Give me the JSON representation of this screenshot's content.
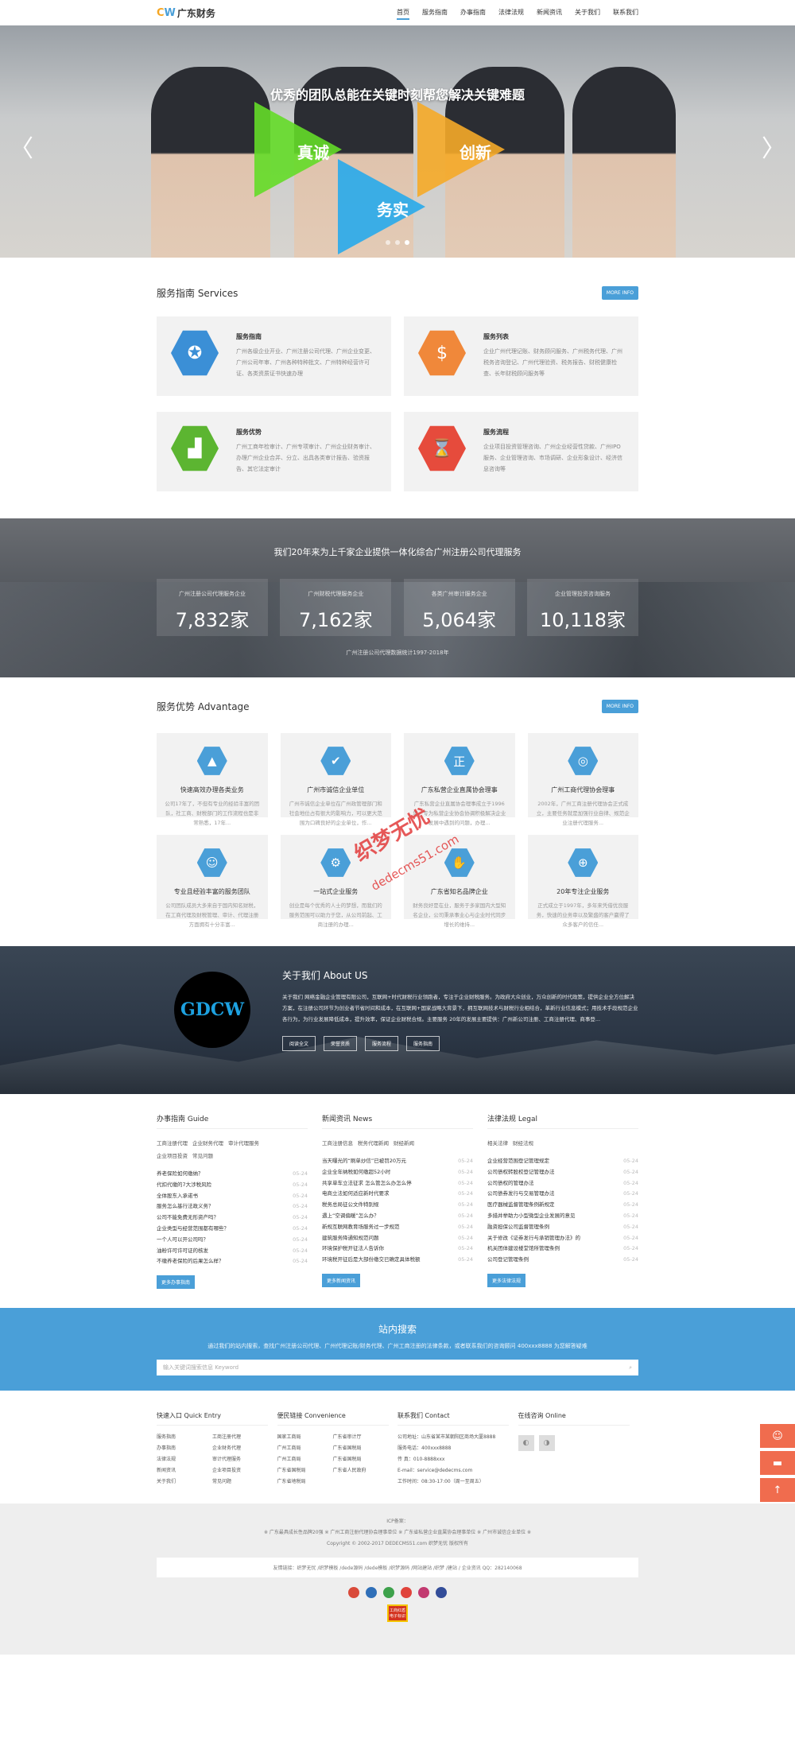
{
  "header": {
    "logo_c": "C",
    "logo_w": "W",
    "logo_text": "广东财务",
    "nav": [
      "首页",
      "服务指南",
      "办事指南",
      "法律法规",
      "新闻资讯",
      "关于我们",
      "联系我们"
    ]
  },
  "banner": {
    "title": "优秀的团队总能在关键时刻帮您解决关键难题",
    "words": [
      "真诚",
      "创新",
      "务实"
    ],
    "prev": "〈",
    "next": "〉"
  },
  "services": {
    "title": "服务指南 Services",
    "more": "MORE INFO",
    "items": [
      {
        "title": "服务指南",
        "desc": "广州各级企业开业、广州注册公司代理、广州企业变更、广州公司年审、广州各种特种批文、广州特种经营许可证、各类资质证书快速办理",
        "color": "#3b8fd6",
        "icon": "award-icon",
        "glyph": "✪"
      },
      {
        "title": "服务列表",
        "desc": "企业广州代理记账、财务顾问服务、广州税务代理、广州税务咨询登记、广州代理验资、税务报告、财税健康检查、长年财税顾问服务等",
        "color": "#f0883a",
        "icon": "money-bag-icon",
        "glyph": "$"
      },
      {
        "title": "服务优势",
        "desc": "广州工商年检审计、广州专项审计、广州企业财务审计、办理广州企业合并、分立、出具各类审计报告、验资报告、其它法定审计",
        "color": "#5cb531",
        "icon": "chart-icon",
        "glyph": "▟"
      },
      {
        "title": "服务流程",
        "desc": "企业项目投资管理咨询、广州企业经营性贷款、广州IPO服务、企业管理咨询、市场调研、企业形象设计、经济信息咨询等",
        "color": "#e64b3c",
        "icon": "hourglass-icon",
        "glyph": "⌛"
      }
    ]
  },
  "stats": {
    "title": "我们20年来为上千家企业提供一体化综合广州注册公司代理服务",
    "items": [
      {
        "label": "广州注册公司代理服务企业",
        "value": "7,832家"
      },
      {
        "label": "广州财税代理服务企业",
        "value": "7,162家"
      },
      {
        "label": "各类广州审计服务企业",
        "value": "5,064家"
      },
      {
        "label": "企业管理投资咨询服务",
        "value": "10,118家"
      }
    ],
    "footnote": "广州注册公司代理数据统计1997-2018年"
  },
  "advantage": {
    "title": "服务优势 Advantage",
    "more": "MORE INFO",
    "items": [
      {
        "title": "快速高效办理各类业务",
        "desc": "公司17年了，不但有专业的经验丰富的团队，社工商、财税部门的工作流程也是非常熟悉，17年...",
        "icon": "chart-up-icon",
        "glyph": "▲"
      },
      {
        "title": "广州市诚信企业单位",
        "desc": "广州市诚信企业单位在广州政管理部门和社会地位占有很大的影响力，可以更大范围为口碑良好的企业单位，作...",
        "icon": "shield-check-icon",
        "glyph": "✔"
      },
      {
        "title": "广东私营企业直属协会理事",
        "desc": "广东私营企业直属协会理事成立于1996年、专为私营企业协会协调积极解决企业发展中遇到的问题，办理...",
        "icon": "stamp-icon",
        "glyph": "正"
      },
      {
        "title": "广州工商代理协会理事",
        "desc": "2002年，广州工商注册代理协会正式成立，主要任务就是加强行业自律、规范企业注册代理服务...",
        "icon": "badge-icon",
        "glyph": "◎"
      },
      {
        "title": "专业且经验丰富的服务团队",
        "desc": "公司团队成员大多来自于国内知名财税，在工商代理及财税管理、审计、代理注册方面拥有十分丰富...",
        "icon": "team-icon",
        "glyph": "☺"
      },
      {
        "title": "一站式企业服务",
        "desc": "创业是每个优秀的人士的梦想，而我们的服务范围可以助力于您，从公司前起、工商注册的办理...",
        "icon": "gears-icon",
        "glyph": "⚙"
      },
      {
        "title": "广东省知名品牌企业",
        "desc": "财务良好是在业，服务于多家国内大型知名企业，公司秉承事业心与企业时代同步增长的维持...",
        "icon": "thumbs-up-icon",
        "glyph": "✋"
      },
      {
        "title": "20年专注企业服务",
        "desc": "正式成立于1997年，多年来凭借优良服务，快速的业务审以及繁盛的客户赢得了众多客户的信任...",
        "icon": "target-icon",
        "glyph": "⊕"
      }
    ]
  },
  "about": {
    "logo": "GDCW",
    "title": "关于我们 About US",
    "text": "关于我们 网络金融企业管理有限公司，互联网+时代财税行业领跑者，专注于企业财税服务。为政府大众创业，万众创新的时代政策，提供企业全方位解决方案，在注册公司环节为创业者节省时间和成本，在互联网+国家战略大背景下，拥互联网技术与财税行业相结合，革新行业信息模式；用技术手段规范企业各行为，为行业发展降低成本，提升效率，保证企业财税合规。主要服务 20年的发展主要提供：广州新公司注册、工商注册代理、商事登...",
    "buttons": [
      "阅读全文",
      "荣誉资质",
      "服务流程",
      "服务指南"
    ]
  },
  "news": {
    "guide": {
      "title": "办事指南 Guide",
      "tags": [
        "工商注册代理",
        "企业财务代理",
        "审计代理服务",
        "企业项目投资",
        "常见问题"
      ],
      "items": [
        {
          "t": "养老保险如何缴纳？",
          "d": "05-24"
        },
        {
          "t": "代扣代缴的7大涉税风险",
          "d": "05-24"
        },
        {
          "t": "全体股东入承诺书",
          "d": "05-24"
        },
        {
          "t": "服务怎么基行法政义务？",
          "d": "05-24"
        },
        {
          "t": "公司不能免费无形资产吗？",
          "d": "05-24"
        },
        {
          "t": "企业类型与经营范围都有哪些？",
          "d": "05-24"
        },
        {
          "t": "一个人可以开公司吗？",
          "d": "05-24"
        },
        {
          "t": "油粉许可许可证的核发",
          "d": "05-24"
        },
        {
          "t": "不缴养老保险的后果怎么样？",
          "d": "05-24"
        }
      ],
      "more": "更多办事指南"
    },
    "news": {
      "title": "新闻资讯 News",
      "tags": [
        "工商注册信息",
        "税务代理新闻",
        "财经新闻"
      ],
      "items": [
        {
          "t": "当天曝光的“刷单炒信”已被罚20万元",
          "d": "05-24"
        },
        {
          "t": "企业全年纳税如何缴超52小时",
          "d": "05-24"
        },
        {
          "t": "共享单车立法征求 怎么管怎么办怎么停",
          "d": "05-24"
        },
        {
          "t": "电商立法如何适应新时代要求",
          "d": "05-24"
        },
        {
          "t": "税务总局征公文件特别规",
          "d": "05-24"
        },
        {
          "t": "遇上“空调偏暖”怎么办？",
          "d": "05-24"
        },
        {
          "t": "新规互联网教育场服务过一步规范",
          "d": "05-24"
        },
        {
          "t": "建筑服务降通知规范问题",
          "d": "05-24"
        },
        {
          "t": "环境保护税开征法人告诉你",
          "d": "05-24"
        },
        {
          "t": "环境税开征后是大部份缴交已确定具体税额",
          "d": "05-24"
        }
      ],
      "more": "更多新闻资讯"
    },
    "legal": {
      "title": "法律法规 Legal",
      "tags": [
        "相关法律",
        "财经法规"
      ],
      "items": [
        {
          "t": "企业经营范围登记管理规定",
          "d": "05-24"
        },
        {
          "t": "公司债权转股权登记管理办法",
          "d": "05-24"
        },
        {
          "t": "公司债权的管理办法",
          "d": "05-24"
        },
        {
          "t": "公司债券发行与交易管理办法",
          "d": "05-24"
        },
        {
          "t": "医疗器械监督管理条例新规定",
          "d": "05-24"
        },
        {
          "t": "多措并举助力小型微型企业发展的意见",
          "d": "05-24"
        },
        {
          "t": "融资担保公司监督管理条例",
          "d": "05-24"
        },
        {
          "t": "关于修改《证券发行与承销管理办法》的",
          "d": "05-24"
        },
        {
          "t": "机关团体建设楼堂馆所管理条例",
          "d": "05-24"
        },
        {
          "t": "公司登记管理条例",
          "d": "05-24"
        }
      ],
      "more": "更多法律法规"
    }
  },
  "search": {
    "title": "站内搜索",
    "desc": "通过我们的站内搜索，查找广州注册公司代理、广州代理记账/财务代理、广州工商注册的法律条款，或者联系我们的咨询顾问 400xxx8888 为您解答疑难",
    "placeholder": "输入关键词搜索信息 Keyword",
    "icon": "⌕"
  },
  "footer": {
    "quick": {
      "title": "快速入口 Quick Entry",
      "links": [
        "服务指南",
        "工商注册代理",
        "办事指南",
        "企业财务代理",
        "法律法规",
        "审计代理服务",
        "新闻资讯",
        "企业项目投资",
        "关于我们",
        "常见问题"
      ]
    },
    "convenience": {
      "title": "便民链接 Convenience",
      "links": [
        "国家工商局",
        "广东省审计厅",
        "广州工商局",
        "广东省国税局",
        "广州工商局",
        "广东省国税局",
        "广东省国税局",
        "广东省人民政府",
        "广东省地税局",
        ""
      ]
    },
    "contact": {
      "title": "联系我们 Contact",
      "lines": [
        "公司地址：山东省某市某朝阳区商场大厦8888",
        "服务电话：400xxx8888",
        "传  真：010-8888xxx",
        "E-mail：service@dedecms.com",
        "工作时间：08:30-17:00（周一至周五）"
      ]
    },
    "online": {
      "title": "在线咨询 Online"
    }
  },
  "bottom": {
    "icp": "ICP备案：",
    "line1": "※ 广东最具成长性品牌20强 ※ 广州工商注册代理协会理事单位 ※ 广东省私营企业直属协会理事单位 ※ 广州市诚信企业单位 ※",
    "copyright": "Copyright © 2002-2017 DEDECMS51.com 织梦无忧 版权所有",
    "friend": "友情链接：织梦无忧 /织梦模板 /dede源码 /dede模板 /织梦源码 /网站建站 /织梦 /建站 / 企业资讯 QQ：282140068",
    "gov": "工商红盾 电子标识"
  },
  "watermark": {
    "line1": "织梦无忧",
    "line2": "dedecms51.com"
  }
}
